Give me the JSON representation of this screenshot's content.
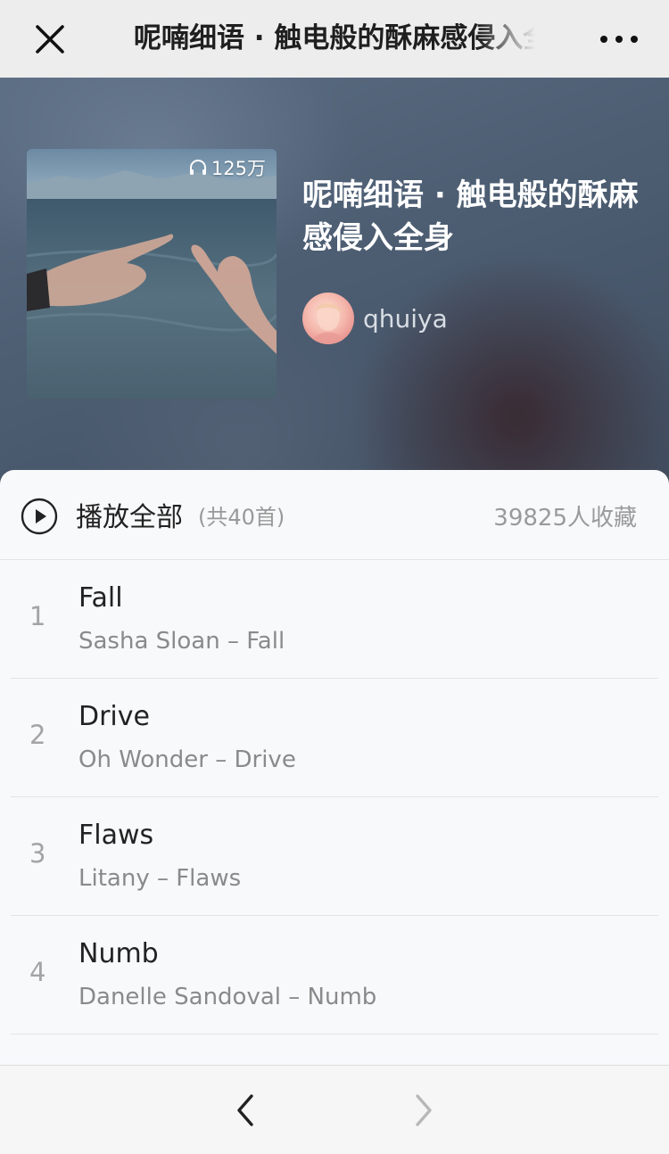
{
  "nav": {
    "title": "呢喃细语 · 触电般的酥麻感侵入全身",
    "close_icon": "close-icon",
    "more_icon": "more-icon"
  },
  "playlist": {
    "title": "呢喃细语 · 触电般的酥麻感侵入全身",
    "play_count": "125万",
    "creator": "qhuiya"
  },
  "list_header": {
    "play_all_label": "播放全部",
    "song_count": "(共40首)",
    "favorites": "39825人收藏"
  },
  "tracks": [
    {
      "num": "1",
      "name": "Fall",
      "sub": "Sasha Sloan – Fall"
    },
    {
      "num": "2",
      "name": "Drive",
      "sub": "Oh Wonder – Drive"
    },
    {
      "num": "3",
      "name": "Flaws",
      "sub": "Litany – Flaws"
    },
    {
      "num": "4",
      "name": "Numb",
      "sub": "Danelle Sandoval – Numb"
    }
  ],
  "colors": {
    "nav_bg": "#ededed",
    "header_bg": "#49586a",
    "panel_bg": "#f8f9fb",
    "primary_text": "#222222",
    "secondary_text": "#8a8a8a"
  }
}
